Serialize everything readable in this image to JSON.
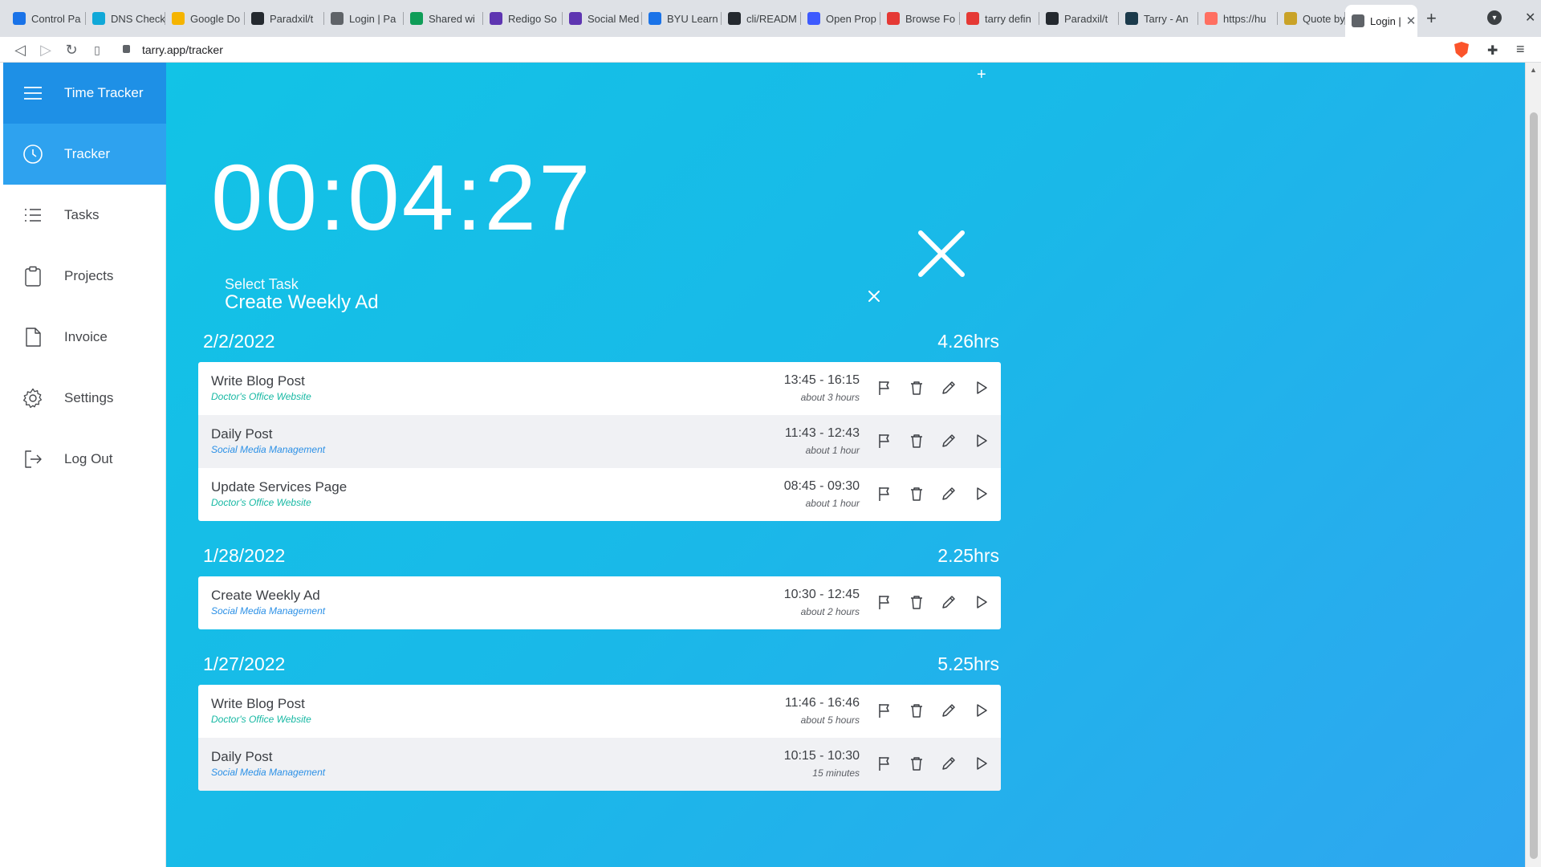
{
  "browser": {
    "tabs": [
      {
        "label": "Control Pa",
        "color": "#1a73e8"
      },
      {
        "label": "DNS Check",
        "color": "#10a8d8"
      },
      {
        "label": "Google Do",
        "color": "#f5b400"
      },
      {
        "label": "Paradxil/t",
        "color": "#24292f"
      },
      {
        "label": "Login | Pa",
        "color": "#5f6368"
      },
      {
        "label": "Shared wi",
        "color": "#0f9d58"
      },
      {
        "label": "Redigo So",
        "color": "#5e35b1"
      },
      {
        "label": "Social Med",
        "color": "#5e35b1"
      },
      {
        "label": "BYU Learn",
        "color": "#1a73e8"
      },
      {
        "label": "cli/READM",
        "color": "#24292f"
      },
      {
        "label": "Open Prop",
        "color": "#3d5afe"
      },
      {
        "label": "Browse Fo",
        "color": "#e53935"
      },
      {
        "label": "tarry defin",
        "color": "#e53935"
      },
      {
        "label": "Paradxil/t",
        "color": "#24292f"
      },
      {
        "label": "Tarry - An",
        "color": "#1b3a4b"
      },
      {
        "label": "https://hu",
        "color": "#ff6f61"
      },
      {
        "label": "Quote by",
        "color": "#c9a227"
      },
      {
        "label": "Login |",
        "color": "#5f6368",
        "active": true
      }
    ],
    "url": "tarry.app/tracker"
  },
  "sidebar": {
    "header": "Time Tracker",
    "items": [
      {
        "label": "Tracker",
        "icon": "clock-icon",
        "active": true
      },
      {
        "label": "Tasks",
        "icon": "list-icon"
      },
      {
        "label": "Projects",
        "icon": "clipboard-icon"
      },
      {
        "label": "Invoice",
        "icon": "document-icon"
      },
      {
        "label": "Settings",
        "icon": "gear-icon"
      },
      {
        "label": "Log Out",
        "icon": "logout-icon"
      }
    ]
  },
  "tracker": {
    "timer": "00:04:27",
    "select_label": "Select Task",
    "selected_task": "Create Weekly Ad"
  },
  "days": [
    {
      "date": "2/2/2022",
      "total": "4.26hrs",
      "entries": [
        {
          "title": "Write Blog Post",
          "project": "Doctor's Office Website",
          "kind": "web",
          "start": "13:45",
          "end": "16:15",
          "duration": "about 3 hours"
        },
        {
          "title": "Daily Post",
          "project": "Social Media Management",
          "kind": "smm",
          "start": "11:43",
          "end": "12:43",
          "duration": "about 1 hour"
        },
        {
          "title": "Update Services Page",
          "project": "Doctor's Office Website",
          "kind": "web",
          "start": "08:45",
          "end": "09:30",
          "duration": "about 1 hour"
        }
      ]
    },
    {
      "date": "1/28/2022",
      "total": "2.25hrs",
      "entries": [
        {
          "title": "Create Weekly Ad",
          "project": "Social Media Management",
          "kind": "smm",
          "start": "10:30",
          "end": "12:45",
          "duration": "about 2 hours"
        }
      ]
    },
    {
      "date": "1/27/2022",
      "total": "5.25hrs",
      "entries": [
        {
          "title": "Write Blog Post",
          "project": "Doctor's Office Website",
          "kind": "web",
          "start": "11:46",
          "end": "16:46",
          "duration": "about 5 hours"
        },
        {
          "title": "Daily Post",
          "project": "Social Media Management",
          "kind": "smm",
          "start": "10:15",
          "end": "10:30",
          "duration": "15 minutes"
        }
      ]
    }
  ],
  "time_separator": " - ",
  "colors": {
    "accent": "#2ea2ef",
    "header": "#1e90e6",
    "web_project": "#16b8a3",
    "smm_project": "#2b90e6"
  }
}
